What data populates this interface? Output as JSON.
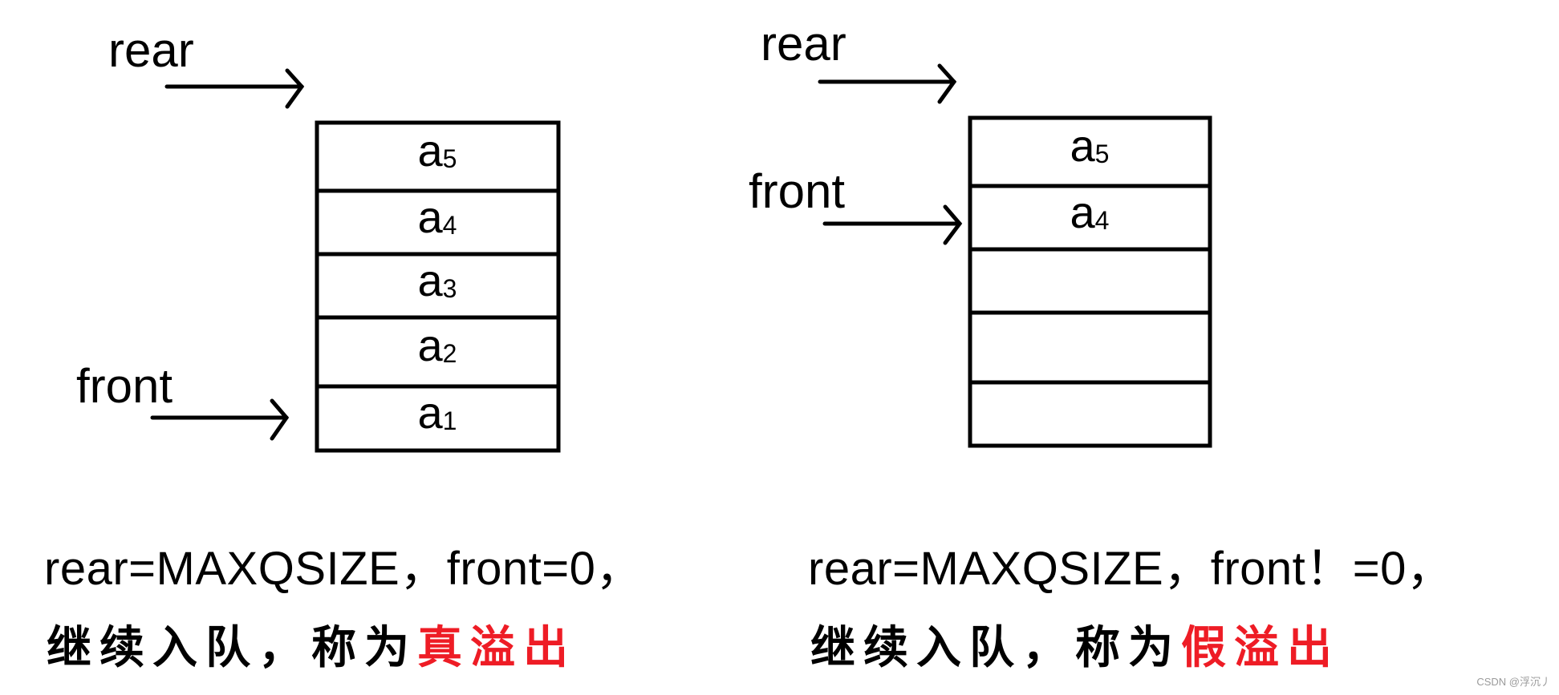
{
  "diagrams": [
    {
      "id": "true-overflow",
      "rear_label": "rear",
      "front_label": "front",
      "rear_points_to_slot": 5,
      "front_points_to_slot": 0,
      "cells": [
        {
          "base": "a",
          "sub": "5"
        },
        {
          "base": "a",
          "sub": "4"
        },
        {
          "base": "a",
          "sub": "3"
        },
        {
          "base": "a",
          "sub": "2"
        },
        {
          "base": "a",
          "sub": "1"
        }
      ],
      "condition": "rear=MAXQSIZE，front=0，",
      "description_prefix": "继续入队，称为",
      "description_highlight": "真溢出"
    },
    {
      "id": "false-overflow",
      "rear_label": "rear",
      "front_label": "front",
      "rear_points_to_slot": 5,
      "front_points_to_slot": 3,
      "cells": [
        {
          "base": "a",
          "sub": "5"
        },
        {
          "base": "a",
          "sub": "4"
        },
        {
          "base": "",
          "sub": ""
        },
        {
          "base": "",
          "sub": ""
        },
        {
          "base": "",
          "sub": ""
        }
      ],
      "condition": "rear=MAXQSIZE，front！=0，",
      "description_prefix": "继续入队，称为",
      "description_highlight": "假溢出"
    }
  ],
  "colors": {
    "ink": "#000000",
    "highlight": "#ee1c25",
    "watermark": "#9a9a9a"
  },
  "watermark": "CSDN @浮沉丿"
}
